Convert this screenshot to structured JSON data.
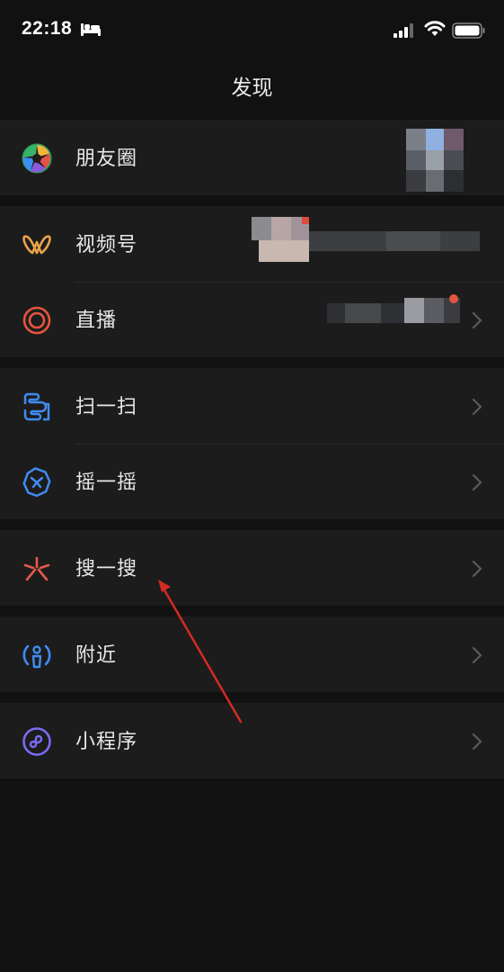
{
  "status_bar": {
    "time": "22:18",
    "icons": [
      "sleep-bed-icon",
      "signal-icon",
      "wifi-icon",
      "battery-icon"
    ]
  },
  "nav": {
    "title": "发现"
  },
  "groups": [
    {
      "items": [
        {
          "label": "朋友圈",
          "icon": "moments-aperture-icon"
        }
      ]
    },
    {
      "items": [
        {
          "label": "视频号",
          "icon": "channels-icon"
        },
        {
          "label": "直播",
          "icon": "live-icon"
        }
      ]
    },
    {
      "items": [
        {
          "label": "扫一扫",
          "icon": "scan-icon"
        },
        {
          "label": "摇一摇",
          "icon": "shake-icon"
        }
      ]
    },
    {
      "items": [
        {
          "label": "搜一搜",
          "icon": "search-star-icon"
        }
      ]
    },
    {
      "items": [
        {
          "label": "附近",
          "icon": "nearby-icon"
        }
      ]
    },
    {
      "items": [
        {
          "label": "小程序",
          "icon": "mini-program-icon"
        }
      ]
    }
  ],
  "colors": {
    "background": "#111111",
    "cell": "#1c1c1c",
    "annotation_arrow": "#d42a24",
    "live_icon": "#e4553f",
    "channels_icon": "#e8a24a",
    "scan_icon": "#3f8cf2",
    "search_icon": "#e45a4a",
    "mini_program_icon": "#7a6cf2"
  },
  "annotations": [
    "red-arrow-pointing-at-search"
  ]
}
